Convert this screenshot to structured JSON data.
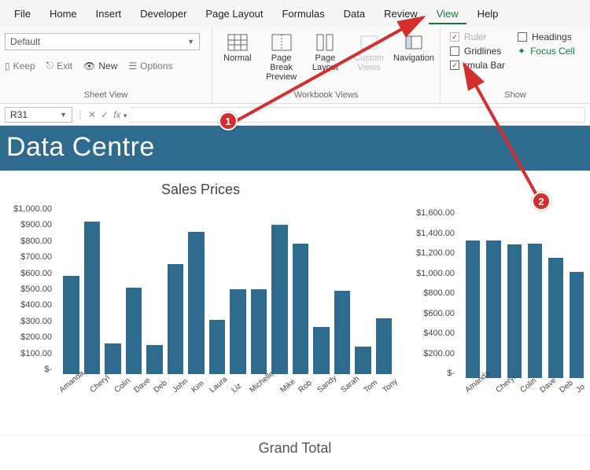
{
  "menu": [
    "File",
    "Home",
    "Insert",
    "Developer",
    "Page Layout",
    "Formulas",
    "Data",
    "Review",
    "View",
    "Help"
  ],
  "menu_active": "View",
  "ribbon": {
    "sheetview": {
      "default_label": "Default",
      "keep": "Keep",
      "exit": "Exit",
      "newv": "New",
      "options": "Options",
      "group_label": "Sheet View"
    },
    "workbook": {
      "normal": "Normal",
      "pagebreak": "Page Break Preview",
      "pagelayout": "Page Layout",
      "custom": "Custom Views",
      "navigation": "Navigation",
      "group_label": "Workbook Views"
    },
    "show": {
      "ruler": "Ruler",
      "gridlines": "Gridlines",
      "formulabar": "rmula Bar",
      "headings": "Headings",
      "focuscell": "Focus Cell",
      "group_label": "Show"
    }
  },
  "formulabar": {
    "cellref": "R31",
    "fx": "fx"
  },
  "banner": "Data Centre",
  "chart_data": [
    {
      "type": "bar",
      "title": "Sales Prices",
      "ylabels": [
        "$1,000.00",
        "$900.00",
        "$800.00",
        "$700.00",
        "$600.00",
        "$500.00",
        "$400.00",
        "$300.00",
        "$200.00",
        "$100.00",
        "$-"
      ],
      "ymax": 1000,
      "categories": [
        "Amanda",
        "Cheryl",
        "Colin",
        "Dave",
        "Deb",
        "John",
        "Kim",
        "Laura",
        "Liz",
        "Michelle",
        "Mike",
        "Rob",
        "Sandy",
        "Sarah",
        "Tom",
        "Tony"
      ],
      "values": [
        580,
        900,
        180,
        510,
        170,
        650,
        840,
        320,
        500,
        500,
        880,
        770,
        280,
        490,
        160,
        330
      ]
    },
    {
      "type": "bar",
      "title": "",
      "ylabels": [
        "$1,600.00",
        "$1,400.00",
        "$1,200.00",
        "$1,000.00",
        "$800.00",
        "$600.00",
        "$400.00",
        "$200.00",
        "$-"
      ],
      "ymax": 1600,
      "categories": [
        "Amanda",
        "Cheryl",
        "Colin",
        "Dave",
        "Deb",
        "Jo"
      ],
      "values": [
        1300,
        1300,
        1260,
        1270,
        1130,
        1000
      ]
    }
  ],
  "grandtotal": "Grand Total",
  "annotations": {
    "n1": "1",
    "n2": "2"
  }
}
